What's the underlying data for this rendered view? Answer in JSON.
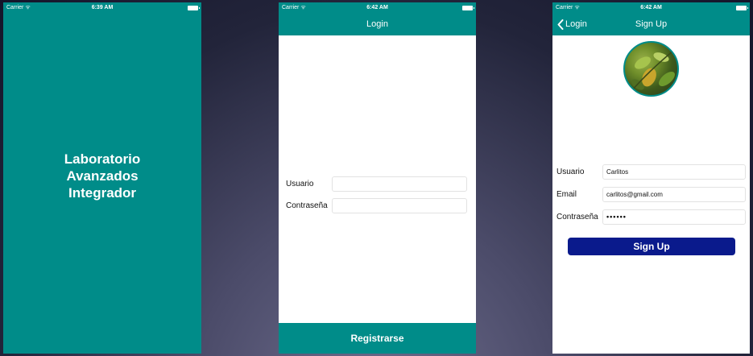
{
  "colors": {
    "primary": "#008c89",
    "signup_button": "#0a1a8c",
    "background": "#2b2b45"
  },
  "status_bar": {
    "carrier": "Carrier ᯤ",
    "phone1_time": "6:39 AM",
    "phone2_time": "6:42 AM",
    "phone3_time": "6:42 AM"
  },
  "splash": {
    "line1": "Laboratorio",
    "line2": "Avanzados",
    "line3": "Integrador"
  },
  "login": {
    "title": "Login",
    "user_label": "Usuario",
    "user_value": "",
    "password_label": "Contraseña",
    "password_value": "",
    "register_button": "Registrarse"
  },
  "signup": {
    "title": "Sign Up",
    "back_label": "Login",
    "avatar_icon": "profile-photo",
    "user_label": "Usuario",
    "user_value": "Carlitos",
    "email_label": "Email",
    "email_value": "carlitos@gmail.com",
    "password_label": "Contraseña",
    "password_value": "••••••",
    "button_label": "Sign Up"
  }
}
